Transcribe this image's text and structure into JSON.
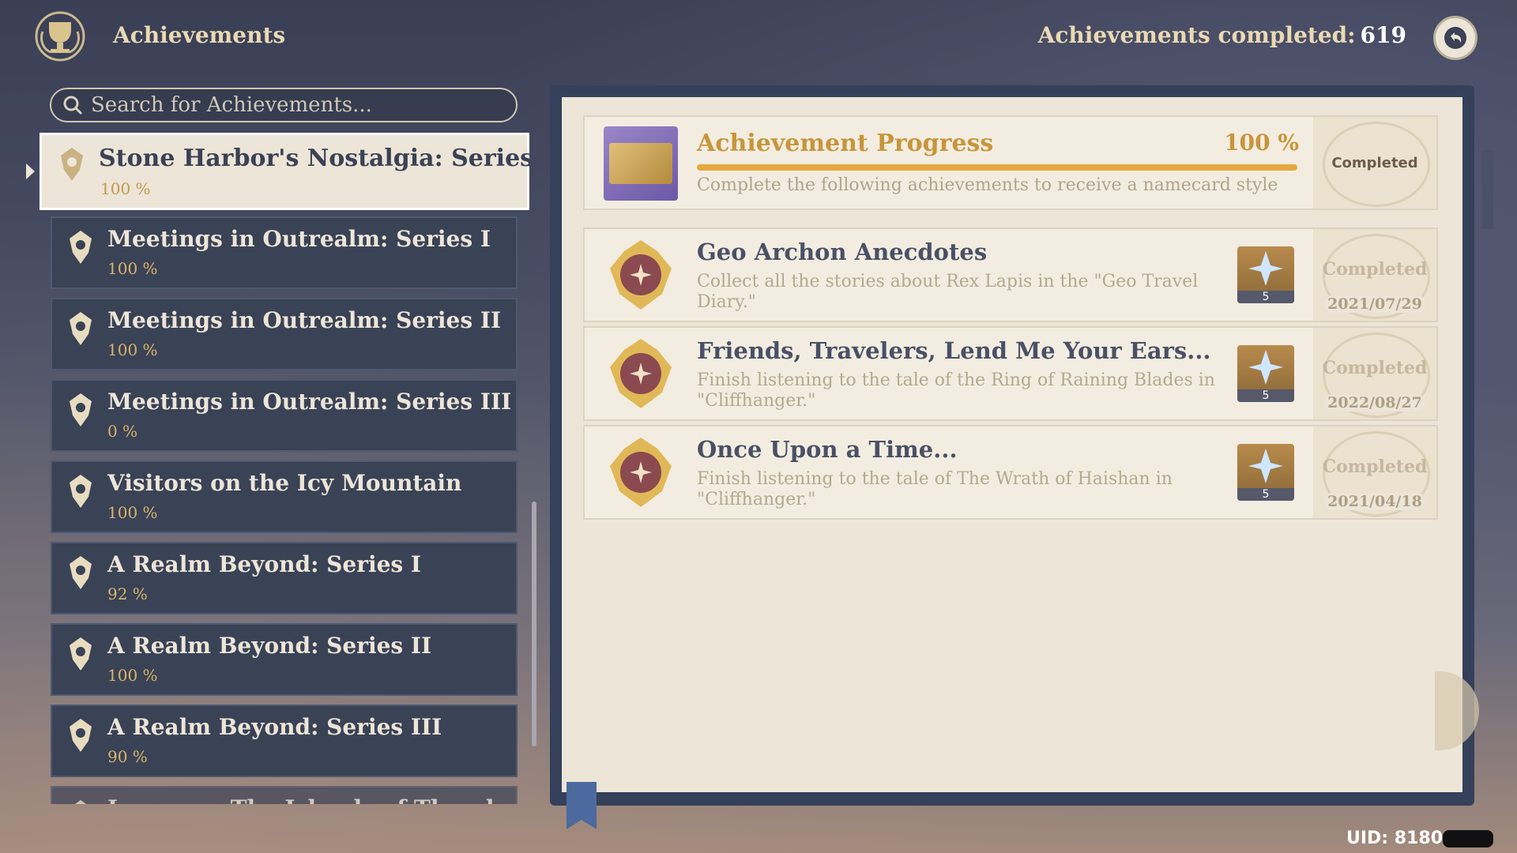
{
  "header": {
    "title": "Achievements",
    "completed_label": "Achievements completed:",
    "completed_count": "619"
  },
  "search": {
    "placeholder": "Search for Achievements..."
  },
  "categories": [
    {
      "name": "Stone Harbor's Nostalgia: Series I",
      "progress": "100 %",
      "active": true
    },
    {
      "name": "Meetings in Outrealm: Series I",
      "progress": "100 %"
    },
    {
      "name": "Meetings in Outrealm: Series II",
      "progress": "100 %"
    },
    {
      "name": "Meetings in Outrealm: Series III",
      "progress": "0 %"
    },
    {
      "name": "Visitors on the Icy Mountain",
      "progress": "100 %"
    },
    {
      "name": "A Realm Beyond: Series I",
      "progress": "92 %"
    },
    {
      "name": "A Realm Beyond: Series II",
      "progress": "100 %"
    },
    {
      "name": "A Realm Beyond: Series III",
      "progress": "90 %"
    },
    {
      "name": "Inazuma: The Islands of Thunder and",
      "progress": ""
    }
  ],
  "progress": {
    "title": "Achievement Progress",
    "percent": "100 %",
    "fill_fraction": 1.0,
    "description": "Complete the following achievements to receive a namecard style",
    "status": "Completed"
  },
  "achievements": [
    {
      "title": "Geo Archon Anecdotes",
      "description": "Collect all the stories about Rex Lapis in the \"Geo Travel Diary.\"",
      "reward_qty": "5",
      "status": "Completed",
      "date": "2021/07/29"
    },
    {
      "title": "Friends, Travelers, Lend Me Your Ears...",
      "description": "Finish listening to the tale of the Ring of Raining Blades in \"Cliffhanger.\"",
      "reward_qty": "5",
      "status": "Completed",
      "date": "2022/08/27"
    },
    {
      "title": "Once Upon a Time...",
      "description": "Finish listening to the tale of The Wrath of Haishan in \"Cliffhanger.\"",
      "reward_qty": "5",
      "status": "Completed",
      "date": "2021/04/18"
    }
  ],
  "footer": {
    "uid_label": "UID: 8180"
  },
  "colors": {
    "accent_gold": "#c8953a",
    "panel_bg": "#ece5d8",
    "sidebar_item": "#3a4256"
  },
  "icons": [
    "trophy-emblem-icon",
    "back-icon",
    "search-icon",
    "achievement-badge-icon",
    "namecard-icon",
    "medal-icon",
    "primogem-icon"
  ]
}
